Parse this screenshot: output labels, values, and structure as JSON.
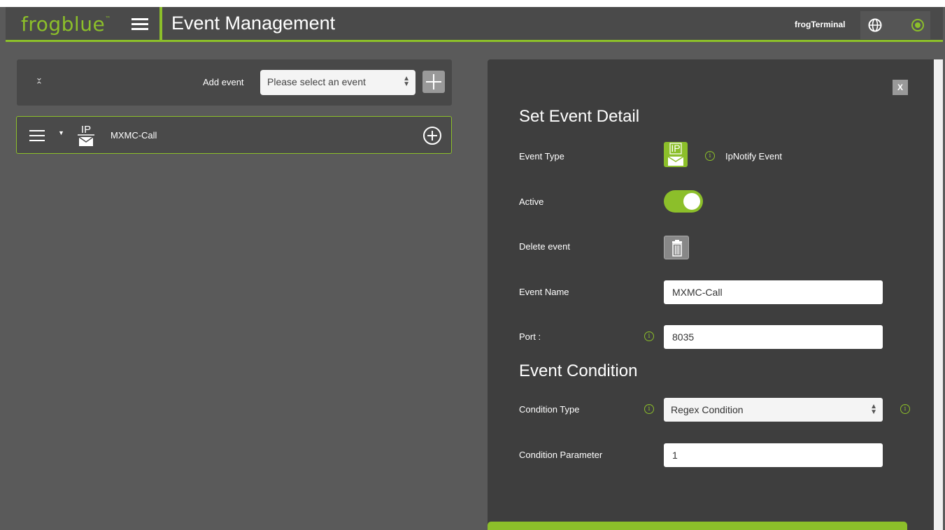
{
  "header": {
    "logo": "frogblue",
    "logo_tm": "™",
    "title": "Event Management",
    "terminal": "frogTerminal"
  },
  "toolbar": {
    "collapse_glyph_up": "⌄",
    "collapse_glyph_down": "⌃",
    "add_event_label": "Add event",
    "select_value": "Please select an event"
  },
  "events": [
    {
      "icon_text": "IP",
      "name": "MXMC-Call"
    }
  ],
  "detail": {
    "close_label": "X",
    "heading": "Set Event Detail",
    "event_type_label": "Event Type",
    "event_type_icon_text": "IP",
    "event_type_value": "IpNotify Event",
    "active_label": "Active",
    "active": true,
    "delete_label": "Delete event",
    "name_label": "Event Name",
    "name_value": "MXMC-Call",
    "port_label": "Port :",
    "port_value": "8035",
    "condition_heading": "Event Condition",
    "condition_type_label": "Condition Type",
    "condition_type_value": "Regex Condition",
    "condition_param_label": "Condition Parameter",
    "condition_param_value": "1"
  },
  "info_glyph": "i",
  "colors": {
    "accent": "#8cbf2a",
    "background": "#5a5a5a",
    "panel": "#3e3e3e"
  }
}
